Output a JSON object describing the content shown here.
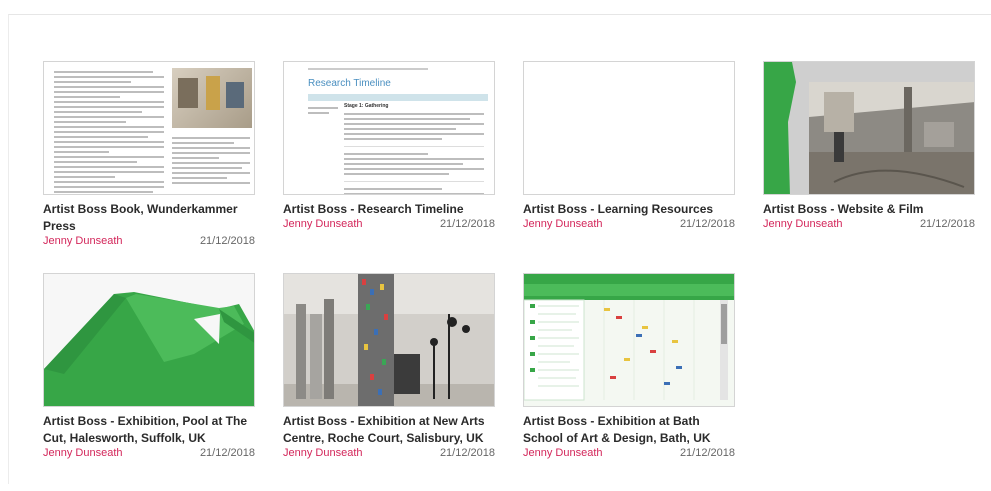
{
  "items": [
    {
      "title": "Artist Boss Book, Wunderkammer Press",
      "author": "Jenny Dunseath",
      "date": "21/12/2018",
      "thumb": "book-pages",
      "thumb_text": "",
      "thumb_table_head": ""
    },
    {
      "title": "Artist Boss - Research Timeline",
      "author": "Jenny Dunseath",
      "date": "21/12/2018",
      "thumb": "document",
      "thumb_text": "Research Timeline",
      "thumb_table_head": "Stage 1: Gathering"
    },
    {
      "title": "Artist Boss - Learning Resources",
      "author": "Jenny Dunseath",
      "date": "21/12/2018",
      "thumb": "blank",
      "thumb_text": "",
      "thumb_table_head": ""
    },
    {
      "title": "Artist Boss - Website & Film",
      "author": "Jenny Dunseath",
      "date": "21/12/2018",
      "thumb": "workshop",
      "thumb_text": "",
      "thumb_table_head": ""
    },
    {
      "title": "Artist Boss - Exhibition, Pool at The Cut, Halesworth, Suffolk, UK",
      "author": "Jenny Dunseath",
      "date": "21/12/2018",
      "thumb": "green-sculpture",
      "thumb_text": "",
      "thumb_table_head": ""
    },
    {
      "title": "Artist Boss - Exhibition at New Arts Centre, Roche Court, Salisbury, UK",
      "author": "Jenny Dunseath",
      "date": "21/12/2018",
      "thumb": "gallery",
      "thumb_text": "",
      "thumb_table_head": ""
    },
    {
      "title": "Artist Boss - Exhibition at Bath School of Art & Design, Bath, UK",
      "author": "Jenny Dunseath",
      "date": "21/12/2018",
      "thumb": "timeline-chart",
      "thumb_text": "",
      "thumb_table_head": ""
    }
  ],
  "colors": {
    "author": "#d3265a",
    "accent_green": "#37a647"
  }
}
